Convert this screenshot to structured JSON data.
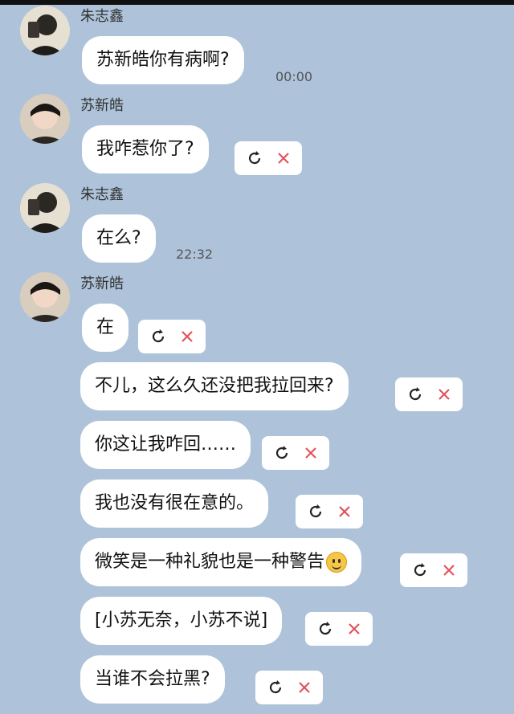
{
  "users": {
    "zhu": {
      "name": "朱志鑫"
    },
    "su": {
      "name": "苏新皓"
    }
  },
  "messages": [
    {
      "sender": "朱志鑫",
      "text": "苏新皓你有病啊?",
      "time": "00:00"
    },
    {
      "sender": "苏新皓",
      "text": "我咋惹你了?",
      "failed": true
    },
    {
      "sender": "朱志鑫",
      "text": "在么?",
      "time": "22:32"
    },
    {
      "sender": "苏新皓",
      "text": "在",
      "failed": true
    },
    {
      "sender": "苏新皓",
      "text": "不儿，这么久还没把我拉回来?",
      "failed": true
    },
    {
      "sender": "苏新皓",
      "text": "你这让我咋回……",
      "failed": true
    },
    {
      "sender": "苏新皓",
      "text": "我也没有很在意的。",
      "failed": true
    },
    {
      "sender": "苏新皓",
      "text": "微笑是一种礼貌也是一种警告",
      "emoji": "slightly-smiling-face",
      "failed": true
    },
    {
      "sender": "苏新皓",
      "text": "[小苏无奈，小苏不说]",
      "failed": true
    },
    {
      "sender": "苏新皓",
      "text": "当谁不会拉黑?",
      "failed": true
    }
  ],
  "colors": {
    "background": "#aec3d9",
    "bubble": "#ffffff",
    "close": "#e0545d"
  }
}
